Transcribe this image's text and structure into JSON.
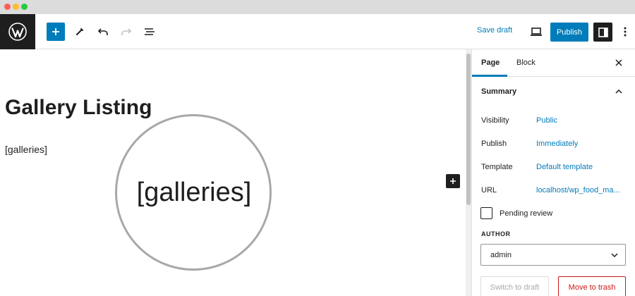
{
  "toolbar": {
    "logo_icon": "wordpress-logo-icon",
    "add_icon": "plus-icon",
    "tools_icon": "pencil-icon",
    "undo_icon": "undo-icon",
    "redo_icon": "redo-icon",
    "list_view_icon": "list-view-icon",
    "save_draft_label": "Save draft",
    "preview_icon": "laptop-icon",
    "publish_label": "Publish",
    "settings_icon": "sidebar-toggle-icon",
    "more_icon": "vertical-ellipsis-icon",
    "accent_color": "#007cba"
  },
  "canvas": {
    "page_title": "Gallery Listing",
    "shortcode": "[galleries]",
    "magnified_text": "[galleries]",
    "inserter_icon": "plus-icon"
  },
  "sidebar": {
    "tabs": [
      {
        "label": "Page",
        "active": true
      },
      {
        "label": "Block",
        "active": false
      }
    ],
    "close_icon": "close-icon",
    "summary": {
      "title": "Summary",
      "chevron_icon": "chevron-up-icon",
      "rows": [
        {
          "label": "Visibility",
          "value": "Public"
        },
        {
          "label": "Publish",
          "value": "Immediately"
        },
        {
          "label": "Template",
          "value": "Default template"
        },
        {
          "label": "URL",
          "value": "localhost/wp_food_ma..."
        }
      ],
      "pending_review_label": "Pending review",
      "pending_review_checked": false,
      "author_label": "AUTHOR",
      "author_value": "admin",
      "switch_to_draft_label": "Switch to draft",
      "move_to_trash_label": "Move to trash",
      "trash_color": "#cc1818"
    }
  }
}
